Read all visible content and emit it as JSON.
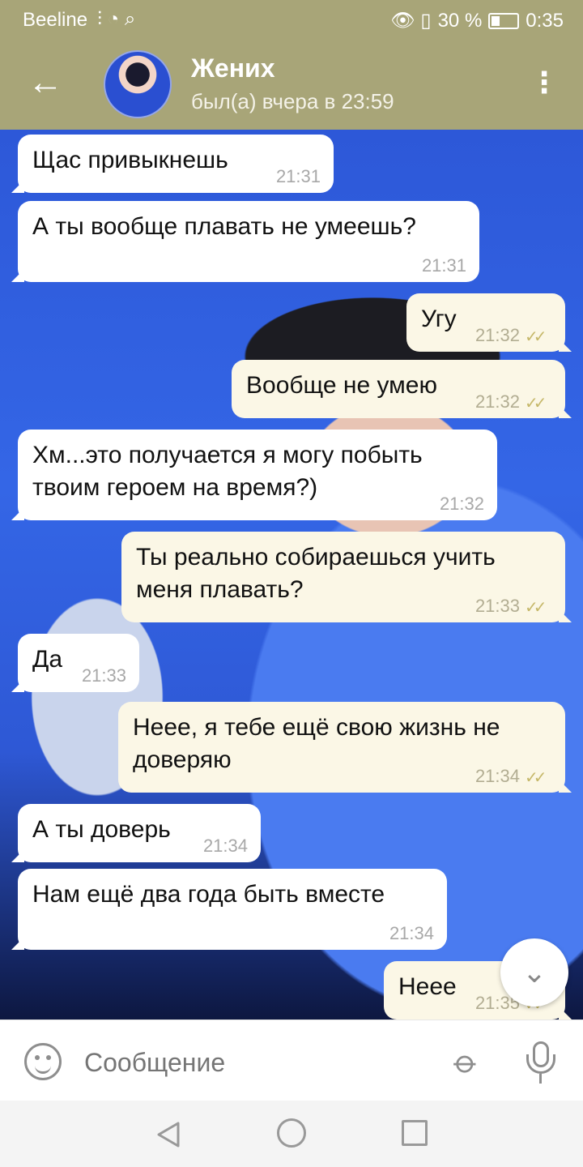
{
  "status_bar": {
    "carrier": "Beeline",
    "signal_icons": "⫶ ◔ ⌕",
    "right_icons": "👁 ▯",
    "battery_text": "30 %",
    "time": "0:35"
  },
  "header": {
    "title": "Жених",
    "subtitle": "был(а) вчера в 23:59",
    "back_glyph": "←",
    "menu_glyph": "⋮"
  },
  "messages": [
    {
      "dir": "in",
      "text": "Щас привыкнешь",
      "time": "21:31"
    },
    {
      "dir": "in",
      "text": "А ты вообще плавать не умеешь?",
      "time": "21:31"
    },
    {
      "dir": "out",
      "text": "Угу",
      "time": "21:32",
      "read": true
    },
    {
      "dir": "out",
      "text": "Вообще не умею",
      "time": "21:32",
      "read": true
    },
    {
      "dir": "in",
      "text": "Хм...это получается я могу побыть твоим героем на время?)",
      "time": "21:32"
    },
    {
      "dir": "out",
      "text": "Ты реально собираешься учить меня плавать?",
      "time": "21:33",
      "read": true
    },
    {
      "dir": "in",
      "text": "Да",
      "time": "21:33"
    },
    {
      "dir": "out",
      "text": "Неее, я тебе ещё свою жизнь не доверяю",
      "time": "21:34",
      "read": true
    },
    {
      "dir": "in",
      "text": "А ты доверь",
      "time": "21:34"
    },
    {
      "dir": "in",
      "text": "Нам ещё два года быть вместе",
      "time": "21:34"
    },
    {
      "dir": "out",
      "text": "Неее",
      "time": "21:35",
      "read": true
    }
  ],
  "read_checks_glyph": "✓✓",
  "composer": {
    "placeholder": "Сообщение",
    "attach_glyph": "⌀"
  },
  "scroll_down_glyph": "⌄",
  "navbar": {
    "back_icon": "triangle-back-icon",
    "home_icon": "circle-home-icon",
    "recent_icon": "square-recent-icon"
  },
  "colors": {
    "header": "#a8a578",
    "incoming_bubble": "#ffffff",
    "outgoing_bubble": "#fbf7e6",
    "check": "#c6b86a"
  }
}
